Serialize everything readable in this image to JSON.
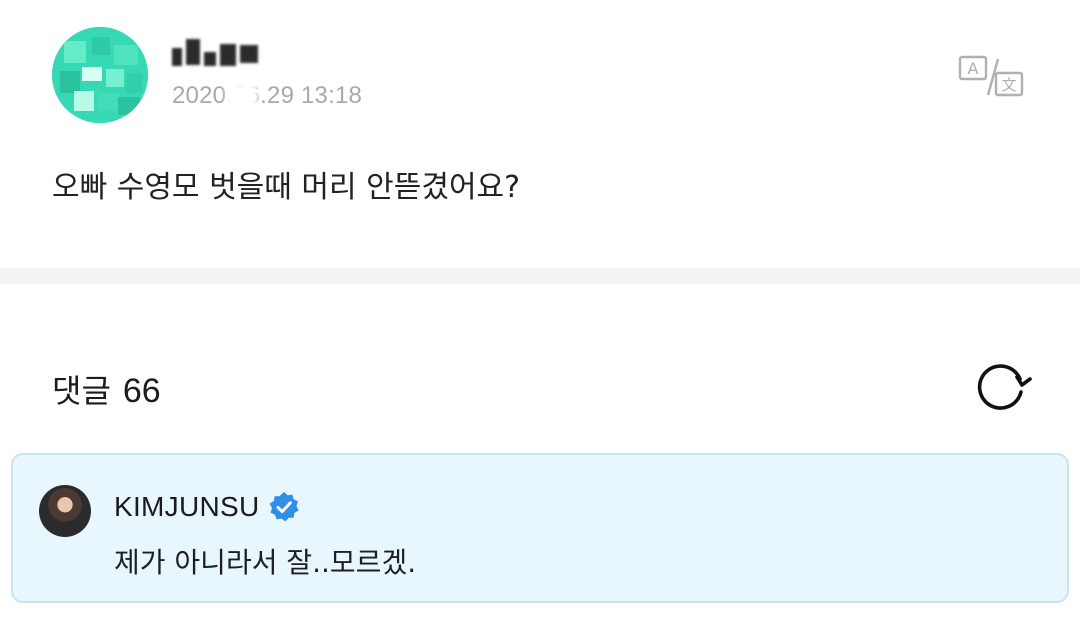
{
  "post": {
    "author_name": "내꺼",
    "date": "2020.06.29 13:18",
    "body": "오빠 수영모 벗을때 머리 안뜯겼어요?",
    "translate_icon": "translate-icon"
  },
  "comments": {
    "label": "댓글",
    "count": "66",
    "refresh_icon": "refresh-icon"
  },
  "highlighted_comment": {
    "author": "KIMJUNSU",
    "verified_icon": "verified-badge-icon",
    "text": "제가 아니라서 잘..모르겠."
  },
  "colors": {
    "avatar_green": "#3ee0b6",
    "comment_bg": "#e8f6fd",
    "comment_border": "#c9e4ef",
    "verified_blue": "#2f8fe8",
    "date_grey": "#a9a9a9",
    "divider": "#f2f3f5"
  }
}
